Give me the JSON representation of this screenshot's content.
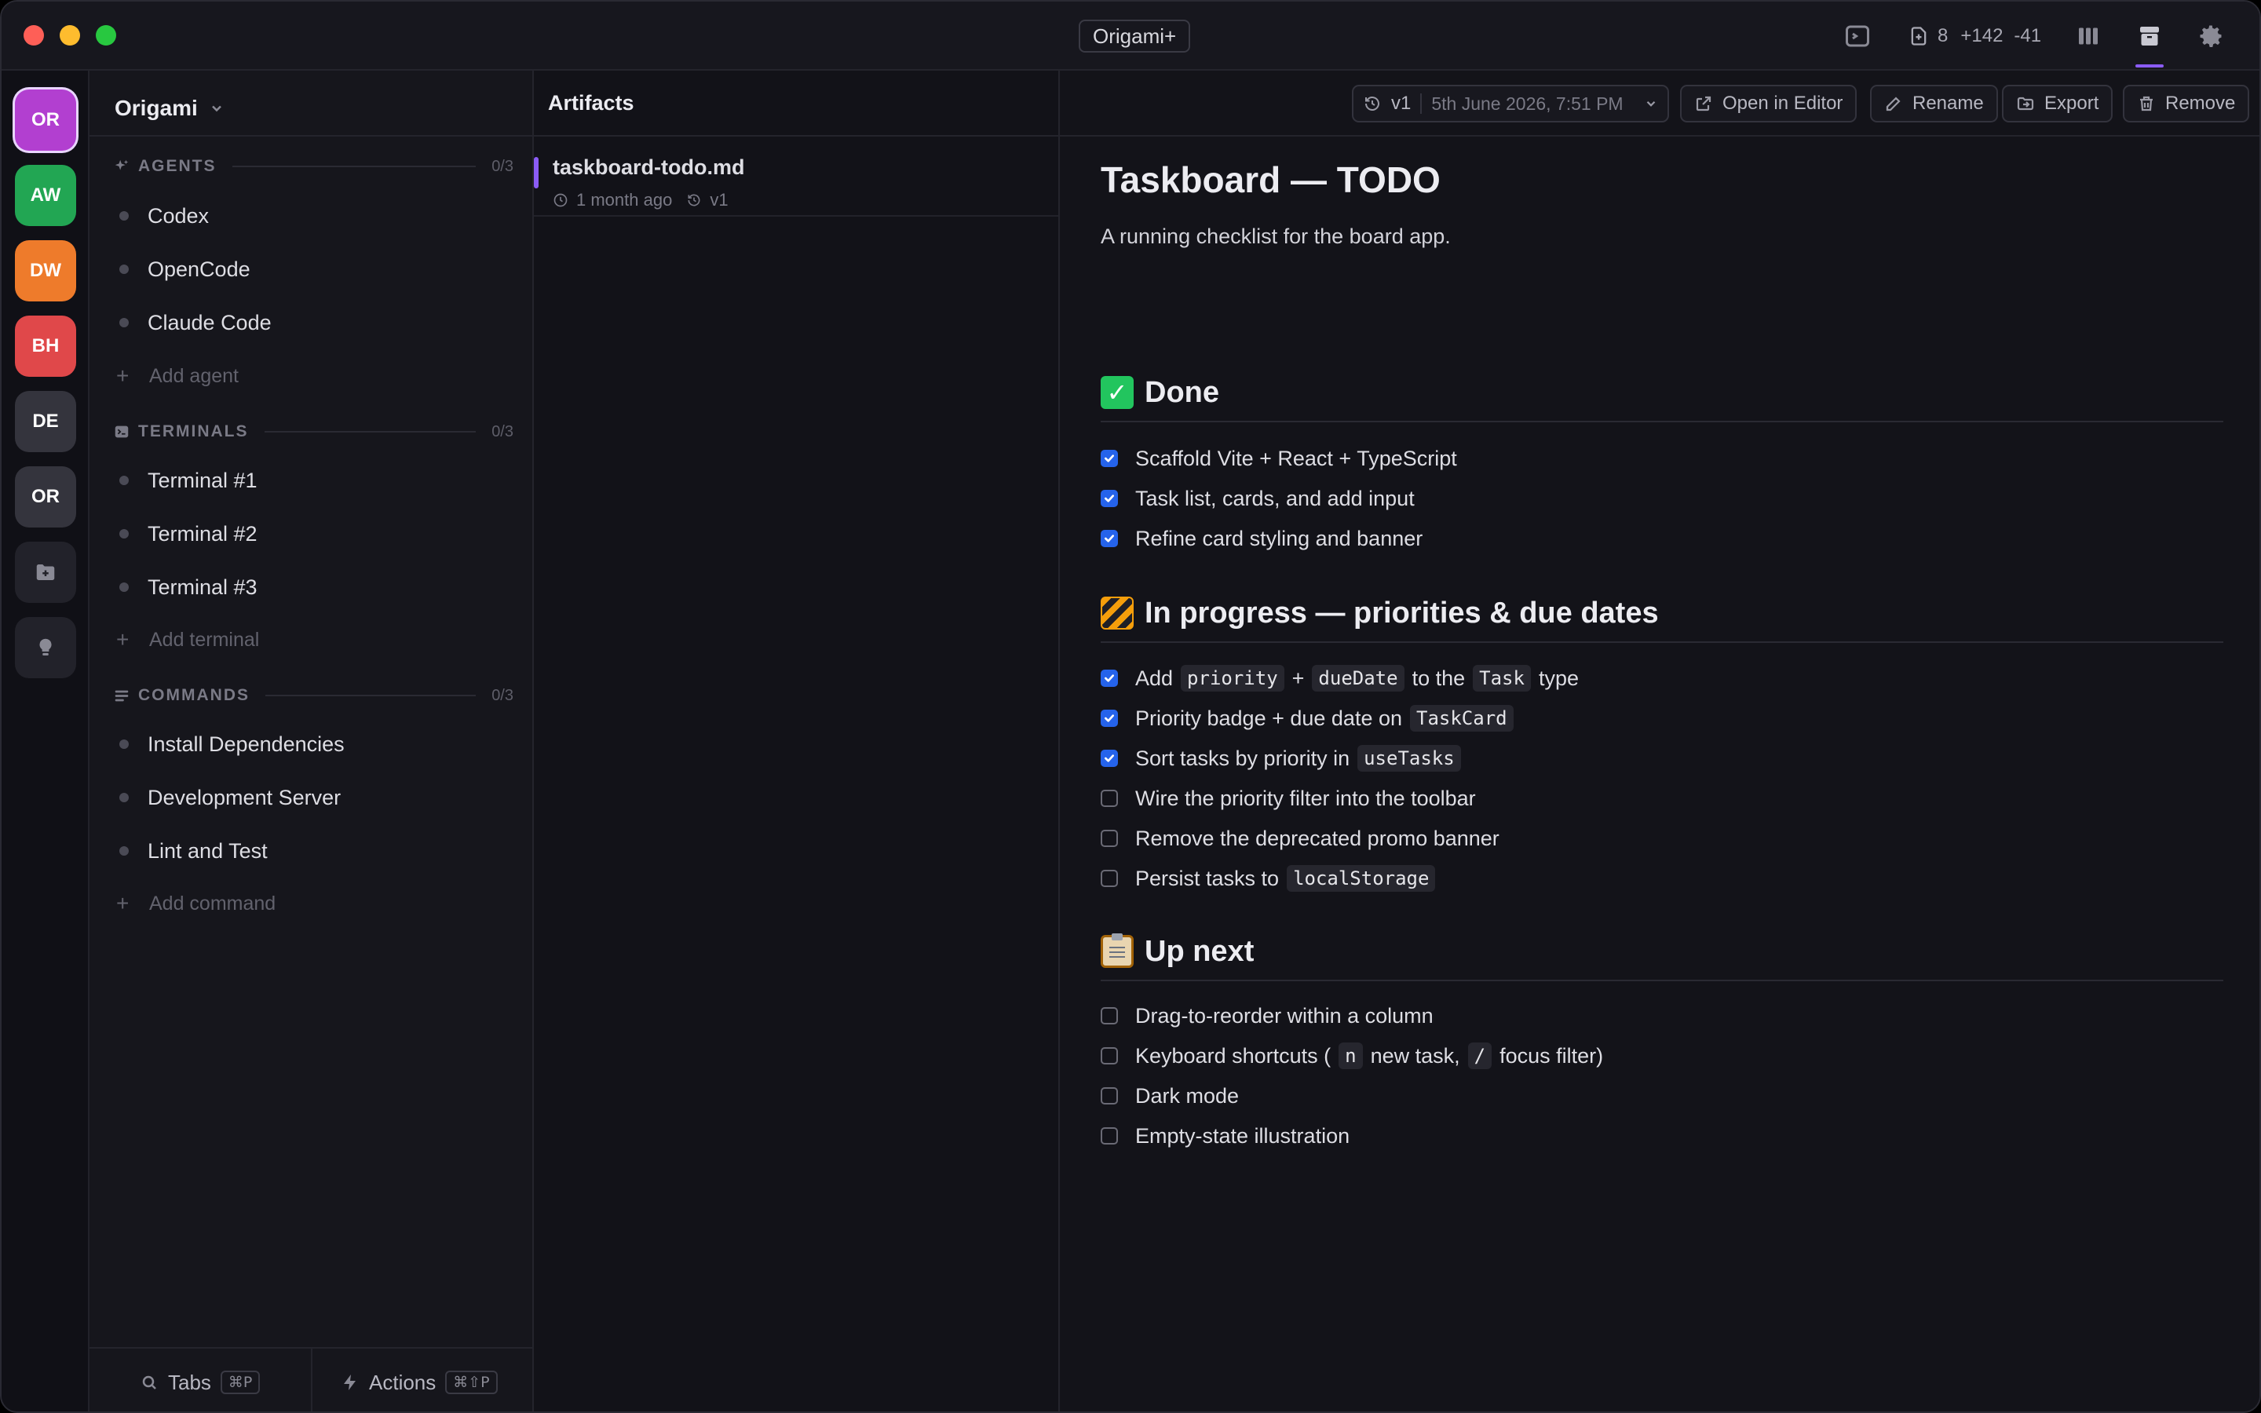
{
  "titlebar": {
    "title": "Origami+",
    "diff": {
      "files": "8",
      "added": "+142",
      "removed": "-41"
    }
  },
  "workspaces": [
    {
      "initials": "OR",
      "color": "#b23fd0",
      "active": true
    },
    {
      "initials": "AW",
      "color": "#22a653"
    },
    {
      "initials": "DW",
      "color": "#ee7b2b"
    },
    {
      "initials": "BH",
      "color": "#e0484a"
    },
    {
      "initials": "DE",
      "color": "#34343d"
    },
    {
      "initials": "OR",
      "color": "#34343d"
    }
  ],
  "sidebar": {
    "project": "Origami",
    "agents": {
      "title": "AGENTS",
      "count": "0/3",
      "items": [
        "Codex",
        "OpenCode",
        "Claude Code"
      ],
      "add_label": "Add agent"
    },
    "terminals": {
      "title": "TERMINALS",
      "count": "0/3",
      "items": [
        "Terminal #1",
        "Terminal #2",
        "Terminal #3"
      ],
      "add_label": "Add terminal"
    },
    "commands": {
      "title": "COMMANDS",
      "count": "0/3",
      "items": [
        "Install Dependencies",
        "Development Server",
        "Lint and Test"
      ],
      "add_label": "Add command"
    },
    "footer": {
      "tabs_label": "Tabs",
      "tabs_kbd": "⌘P",
      "actions_label": "Actions",
      "actions_kbd": "⌘⇧P"
    }
  },
  "artifacts": {
    "title": "Artifacts",
    "items": [
      {
        "name": "taskboard-todo.md",
        "age": "1 month ago",
        "version": "v1"
      }
    ]
  },
  "document": {
    "toolbar": {
      "version": "v1",
      "date": "5th June 2026, 7:51 PM",
      "open_label": "Open in Editor",
      "rename_label": "Rename",
      "export_label": "Export",
      "remove_label": "Remove"
    },
    "title": "Taskboard — TODO",
    "intro": "A running checklist for the board app.",
    "sections": [
      {
        "heading": "Done",
        "emoji": "check-mark-button",
        "tasks": [
          {
            "done": true,
            "parts": [
              {
                "t": "Scaffold Vite + React + TypeScript"
              }
            ]
          },
          {
            "done": true,
            "parts": [
              {
                "t": "Task list, cards, and add input"
              }
            ]
          },
          {
            "done": true,
            "parts": [
              {
                "t": "Refine card styling and banner"
              }
            ]
          }
        ]
      },
      {
        "heading": "In progress — priorities & due dates",
        "emoji": "construction-barrier",
        "tasks": [
          {
            "done": true,
            "parts": [
              {
                "t": "Add"
              },
              {
                "c": "priority"
              },
              {
                "t": "+"
              },
              {
                "c": "dueDate"
              },
              {
                "t": "to the"
              },
              {
                "c": "Task"
              },
              {
                "t": "type"
              }
            ]
          },
          {
            "done": true,
            "parts": [
              {
                "t": "Priority badge + due date on"
              },
              {
                "c": "TaskCard"
              }
            ]
          },
          {
            "done": true,
            "parts": [
              {
                "t": "Sort tasks by priority in"
              },
              {
                "c": "useTasks"
              }
            ]
          },
          {
            "done": false,
            "parts": [
              {
                "t": "Wire the priority filter into the toolbar"
              }
            ]
          },
          {
            "done": false,
            "parts": [
              {
                "t": "Remove the deprecated promo banner"
              }
            ]
          },
          {
            "done": false,
            "parts": [
              {
                "t": "Persist tasks to"
              },
              {
                "c": "localStorage"
              }
            ]
          }
        ]
      },
      {
        "heading": "Up next",
        "emoji": "clipboard",
        "tasks": [
          {
            "done": false,
            "parts": [
              {
                "t": "Drag-to-reorder within a column"
              }
            ]
          },
          {
            "done": false,
            "parts": [
              {
                "t": "Keyboard shortcuts ("
              },
              {
                "c": "n"
              },
              {
                "t": "new task,"
              },
              {
                "c": "/"
              },
              {
                "t": "focus filter)"
              }
            ]
          },
          {
            "done": false,
            "parts": [
              {
                "t": "Dark mode"
              }
            ]
          },
          {
            "done": false,
            "parts": [
              {
                "t": "Empty-state illustration"
              }
            ]
          }
        ]
      }
    ]
  }
}
